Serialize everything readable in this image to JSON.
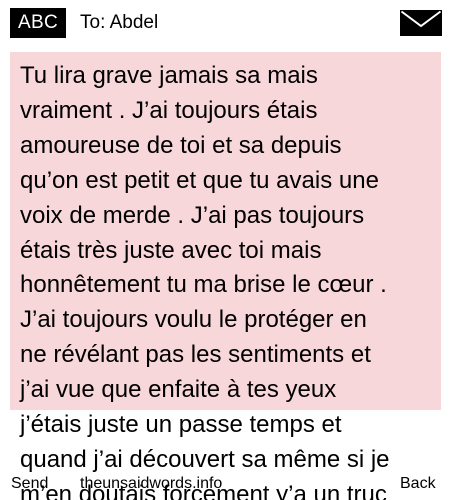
{
  "header": {
    "input_mode": "ABC",
    "recipient": "To: Abdel",
    "icon": "envelope-icon"
  },
  "message": {
    "text": "Tu lira grave jamais sa mais\nvraiment . J’ai toujours étais\namoureuse de toi et sa depuis\nqu’on est petit et que tu avais une\nvoix de merde . J’ai pas toujours\nétais très juste avec toi mais\nhonnêtement tu ma brise le cœur .\nJ’ai toujours voulu le protéger en\nne révélant pas les sentiments et\nj’ai vue que enfaite à tes yeux\nj’étais juste un passe temps et\nquand j’ai découvert sa même si je\nm’en doutais forcement y’a un truc",
    "background": "#f8d7da"
  },
  "footer": {
    "send_label": "Send",
    "site_label": "theunsaidwords.info",
    "back_label": "Back"
  }
}
